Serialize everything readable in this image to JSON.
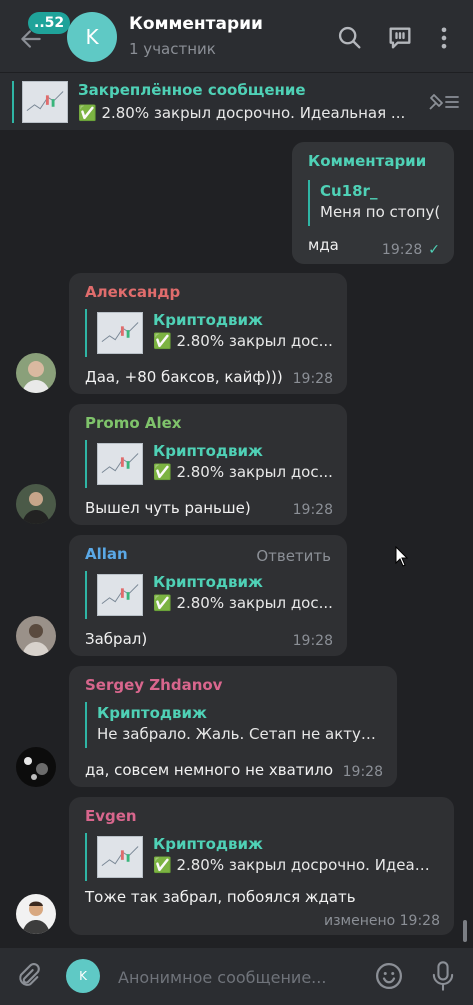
{
  "header": {
    "unread_count": "..52",
    "avatar_letter": "K",
    "title": "Комментарии",
    "subtitle": "1 участник"
  },
  "pinned": {
    "title": "Закреплённое сообщение",
    "text": "✅ 2.80% закрыл досрочно. Идеальная ..."
  },
  "messages": [
    {
      "sender": "Комментарии",
      "sender_color": "#4fd1b6",
      "quote_name": "Cu18r_",
      "quote_text": "Меня по стопу(",
      "text": "мда",
      "time": "19:28",
      "outgoing": true
    },
    {
      "sender": "Александр",
      "sender_color": "#e06c6c",
      "quote_name": "Криптодвиж",
      "quote_text": "✅ 2.80% закрыл дос...",
      "text": "Даа, +80 баксов, кайф)))",
      "time": "19:28"
    },
    {
      "sender": "Promo Alex",
      "sender_color": "#7fc36b",
      "quote_name": "Криптодвиж",
      "quote_text": "✅ 2.80% закрыл дос...",
      "text": "Вышел чуть раньше)",
      "time": "19:28"
    },
    {
      "sender": "Allan",
      "sender_color": "#5aa8e6",
      "reply_label": "Ответить",
      "quote_name": "Криптодвиж",
      "quote_text": "✅ 2.80% закрыл дос...",
      "text": "Забрал)",
      "time": "19:28"
    },
    {
      "sender": "Sergey Zhdanov",
      "sender_color": "#d8668d",
      "quote_name": "Криптодвиж",
      "quote_text": "Не забрало. Жаль. Сетап не актуал...",
      "text": "да, совсем немного не хватило",
      "time": "19:28"
    },
    {
      "sender": "Evgen",
      "sender_color": "#d8668d",
      "quote_name": "Криптодвиж",
      "quote_text": "✅ 2.80% закрыл досрочно. Идеал...",
      "text": "Тоже так забрал, побоялся ждать",
      "time": "изменено 19:28"
    }
  ],
  "composer": {
    "anon_letter": "K",
    "placeholder": "Анонимное сообщение..."
  },
  "colors": {
    "accent": "#2fb5a5",
    "quote_name": "#4fd1b6",
    "bubble": "#2f3033",
    "background": "#202124"
  },
  "icons": [
    "back-arrow-icon",
    "search-icon",
    "comment-icon",
    "more-icon",
    "pin-list-icon",
    "attach-icon",
    "emoji-icon",
    "mic-icon",
    "read-check-icon"
  ]
}
